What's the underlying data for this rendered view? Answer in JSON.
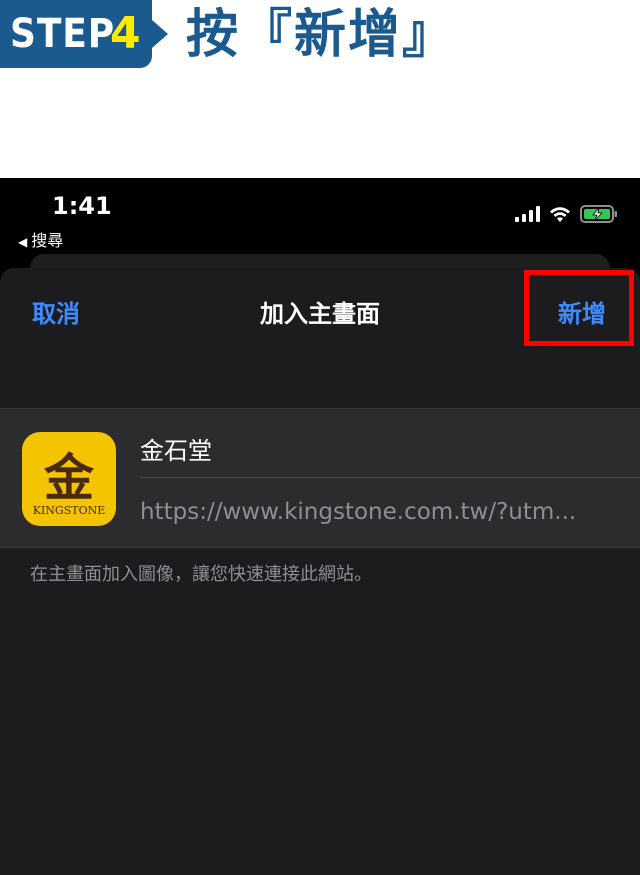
{
  "step_banner": {
    "step_word": "STEP",
    "step_number": "4",
    "instruction": "按『新增』",
    "colors": {
      "tag_bg": "#1a5a8f",
      "number": "#ffeb00",
      "instruction": "#1a5a8f"
    }
  },
  "status_bar": {
    "time": "1:41",
    "back_label": "搜尋",
    "icons": [
      "signal-icon",
      "wifi-icon",
      "battery-charging-icon"
    ]
  },
  "sheet": {
    "cancel_label": "取消",
    "title": "加入主畫面",
    "add_label": "新增",
    "accent_color": "#3d8bff",
    "highlight_color": "#ff0000"
  },
  "bookmark": {
    "app_icon_glyph": "金",
    "app_icon_brand": "KINGSTONE",
    "name": "金石堂",
    "url": "https://www.kingstone.com.tw/?utm..."
  },
  "note": "在主畫面加入圖像，讓您快速連接此網站。"
}
